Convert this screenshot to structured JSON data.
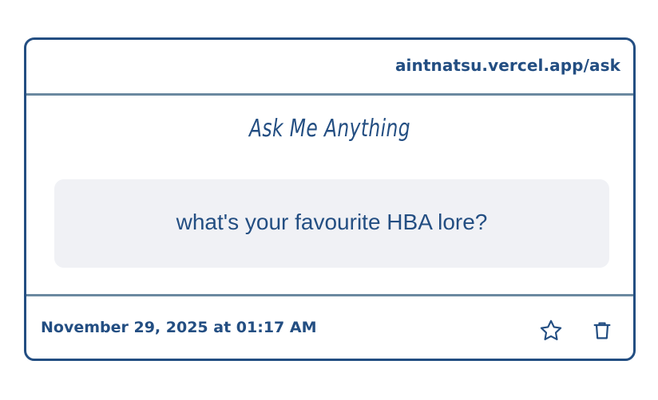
{
  "header": {
    "url": "aintnatsu.vercel.app/ask"
  },
  "main": {
    "title": "Ask Me Anything",
    "question": "what's your favourite HBA lore?"
  },
  "footer": {
    "timestamp": "November 29, 2025 at 01:17 AM",
    "icons": [
      "star-icon",
      "trash-icon"
    ]
  },
  "colors": {
    "accent": "#234e82",
    "divider": "#6b89a0",
    "question_bg": "#f0f1f5",
    "background": "#ffffff"
  }
}
